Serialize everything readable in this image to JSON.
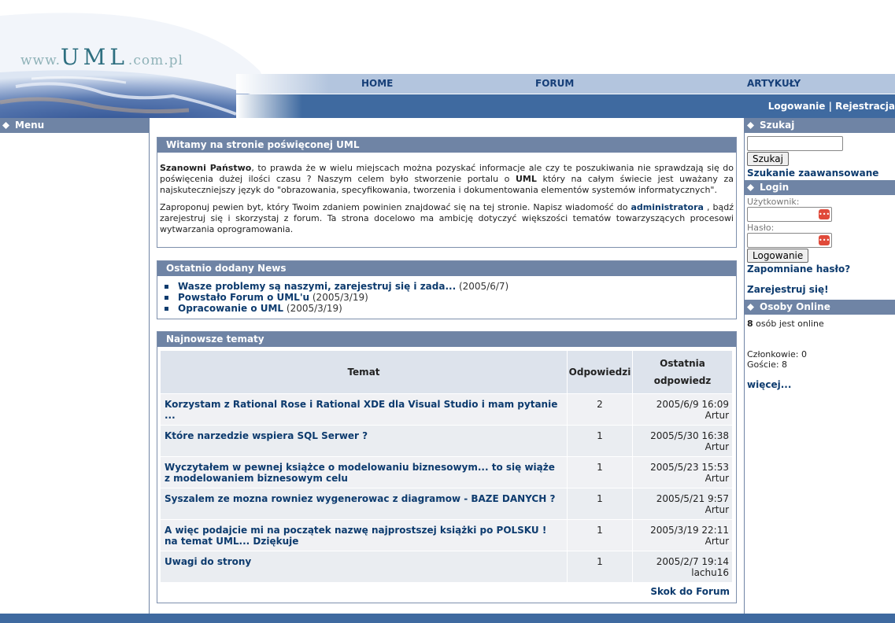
{
  "header": {
    "logo": {
      "www": "www.",
      "uml": "UML",
      "domain": ".com.pl"
    },
    "nav": [
      {
        "label": "HOME"
      },
      {
        "label": "FORUM"
      },
      {
        "label": "ARTYKUŁY"
      }
    ],
    "account": {
      "login": "Logowanie",
      "separator": " | ",
      "register": "Rejestracja"
    }
  },
  "left": {
    "menu_title": "Menu"
  },
  "welcome": {
    "title": "Witamy na stronie poświęconej UML",
    "p1_bold": "Szanowni Państwo",
    "p1_a": ", to prawda że w wielu miejscach można pozyskać informacje ale czy te poszukiwania nie sprawdzają się do poświęcenia dużej ilości czasu ? Naszym celem było stworzenie portalu o ",
    "p1_uml": "UML",
    "p1_b": " który na całym świecie jest uważany za najskuteczniejszy język do \"obrazowania, specyfikowania, tworzenia i dokumentowania elementów systemów informatycznych\".",
    "p2_a": "Zaproponuj pewien byt, który Twoim zdaniem powinien znajdować się na tej stronie. Napisz wiadomość do ",
    "p2_link": "administratora",
    "p2_b": " , bądź zarejestruj się i skorzystaj z forum. Ta strona docelowo ma ambicję dotyczyć większości tematów towarzyszących procesowi wytwarzania oprogramowania."
  },
  "news": {
    "title": "Ostatnio dodany News",
    "items": [
      {
        "title": "Wasze problemy są naszymi, zarejestruj się i zada...",
        "date": "(2005/6/7)"
      },
      {
        "title": "Powstało Forum o UML'u",
        "date": "(2005/3/19)"
      },
      {
        "title": "Opracowanie o UML",
        "date": "(2005/3/19)"
      }
    ]
  },
  "topics": {
    "title": "Najnowsze tematy",
    "headers": {
      "topic": "Temat",
      "replies": "Odpowiedzi",
      "last_1": "Ostatnia",
      "last_2": "odpowiedz"
    },
    "rows": [
      {
        "topic": "Korzystam z Rational Rose i Rational XDE dla Visual Studio i mam pytanie ...",
        "replies": "2",
        "date": "2005/6/9 16:09",
        "user": "Artur"
      },
      {
        "topic": "Które narzedzie wspiera SQL Serwer ?",
        "replies": "1",
        "date": "2005/5/30 16:38",
        "user": "Artur"
      },
      {
        "topic": "Wyczytałem w pewnej książce o modelowaniu biznesowym... to się wiąże z modelowaniem biznesowym celu",
        "replies": "1",
        "date": "2005/5/23 15:53",
        "user": "Artur"
      },
      {
        "topic": "Syszalem ze mozna rowniez wygenerowac z diagramow - BAZE DANYCH ?",
        "replies": "1",
        "date": "2005/5/21 9:57",
        "user": "Artur"
      },
      {
        "topic": "A więc podajcie mi na początek nazwę najprostszej książki po POLSKU ! na temat UML... Dziękuje",
        "replies": "1",
        "date": "2005/3/19 22:11",
        "user": "Artur"
      },
      {
        "topic": "Uwagi do strony",
        "replies": "1",
        "date": "2005/2/7 19:14",
        "user": "lachu16"
      }
    ],
    "more": "Skok do Forum"
  },
  "search": {
    "title": "Szukaj",
    "value": "",
    "button": "Szukaj",
    "advanced": "Szukanie zaawansowane"
  },
  "login": {
    "title": "Login",
    "user_label": "Użytkownik:",
    "pass_label": "Hasło:",
    "button": "Logowanie",
    "forgot": "Zapomniane hasło?",
    "register": "Zarejestruj się!"
  },
  "online": {
    "title": "Osoby Online",
    "count": "8",
    "count_text": " osób jest online",
    "members": "Członkowie: 0",
    "guests": "Goście: 8",
    "more": "więcej..."
  },
  "colors": {
    "bar": "#6f84a5",
    "nav": "#b3c5de",
    "dark_blue": "#3f6aa0",
    "link": "#0d3b6e"
  }
}
